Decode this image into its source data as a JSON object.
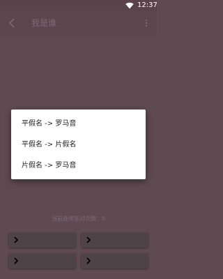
{
  "status_bar": {
    "time": "12:37",
    "icons": [
      "wifi-icon"
    ]
  },
  "app_bar": {
    "title": "我是谁",
    "back_icon": "arrow-back-icon",
    "menu_icon": "more-vert-icon"
  },
  "background_page": {
    "stats_text": "当前连续答对次数：0",
    "buttons": [
      {
        "icon": "chevron-right-icon",
        "label": ""
      },
      {
        "icon": "chevron-right-icon",
        "label": ""
      },
      {
        "icon": "chevron-right-icon",
        "label": ""
      },
      {
        "icon": "chevron-right-icon",
        "label": ""
      }
    ]
  },
  "dialog": {
    "options": [
      {
        "label": "平假名 -> 罗马音"
      },
      {
        "label": "平假名 -> 片假名"
      },
      {
        "label": "片假名 -> 罗马音"
      }
    ]
  },
  "colors": {
    "scrim_background": "#5f4a52",
    "dialog_background": "#ffffff",
    "option_text": "#212121",
    "dimmed_button": "#4e4346"
  }
}
